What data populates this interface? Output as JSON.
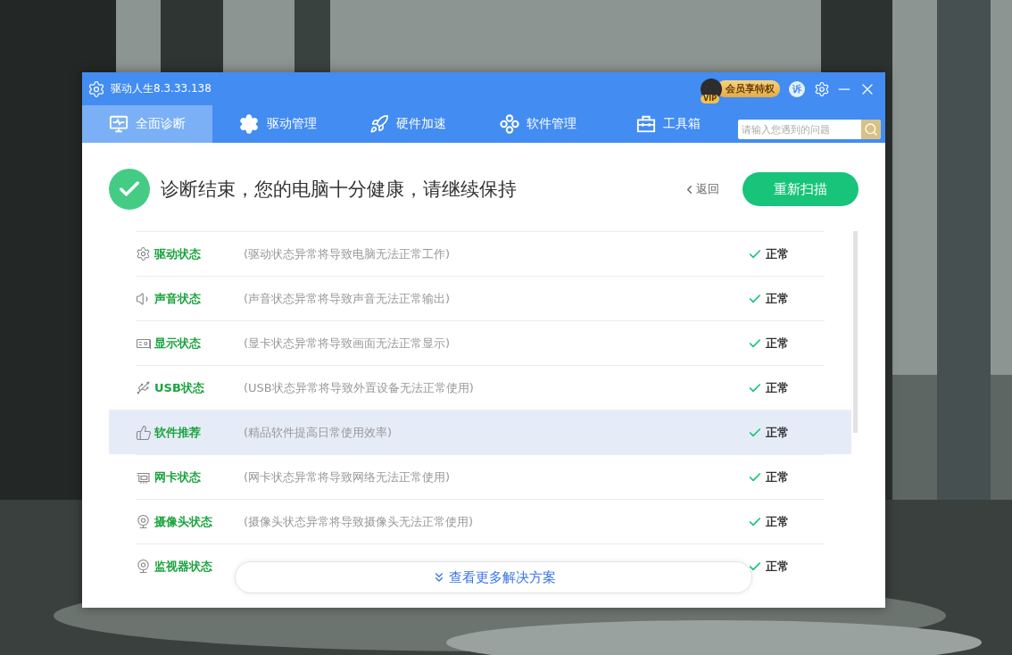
{
  "window": {
    "title": "驱动人生8.3.33.138",
    "vip": {
      "badge": "VIP",
      "label": "会员享特权"
    },
    "complaint": "诉"
  },
  "tabs": [
    {
      "label": "全面诊断",
      "selected": true
    },
    {
      "label": "驱动管理",
      "selected": false
    },
    {
      "label": "硬件加速",
      "selected": false
    },
    {
      "label": "软件管理",
      "selected": false
    },
    {
      "label": "工具箱",
      "selected": false
    }
  ],
  "search": {
    "placeholder": "请输入您遇到的问题"
  },
  "result": {
    "message": "诊断结束，您的电脑十分健康，请继续保持",
    "back": "返回",
    "rescan": "重新扫描"
  },
  "items": [
    {
      "name": "驱动状态",
      "description": "(驱动状态异常将导致电脑无法正常工作)",
      "status": "正常",
      "selected": false
    },
    {
      "name": "声音状态",
      "description": "(声音状态异常将导致声音无法正常输出)",
      "status": "正常",
      "selected": false
    },
    {
      "name": "显示状态",
      "description": "(显卡状态异常将导致画面无法正常显示)",
      "status": "正常",
      "selected": false
    },
    {
      "name": "USB状态",
      "description": "(USB状态异常将导致外置设备无法正常使用)",
      "status": "正常",
      "selected": false
    },
    {
      "name": "软件推荐",
      "description": "(精品软件提高日常使用效率)",
      "status": "正常",
      "selected": true
    },
    {
      "name": "网卡状态",
      "description": "(网卡状态异常将导致网络无法正常使用)",
      "status": "正常",
      "selected": false
    },
    {
      "name": "摄像头状态",
      "description": "(摄像头状态异常将导致摄像头无法正常使用)",
      "status": "正常",
      "selected": false
    },
    {
      "name": "监视器状态",
      "status": "正常",
      "selected": false
    }
  ],
  "more": "查看更多解决方案"
}
